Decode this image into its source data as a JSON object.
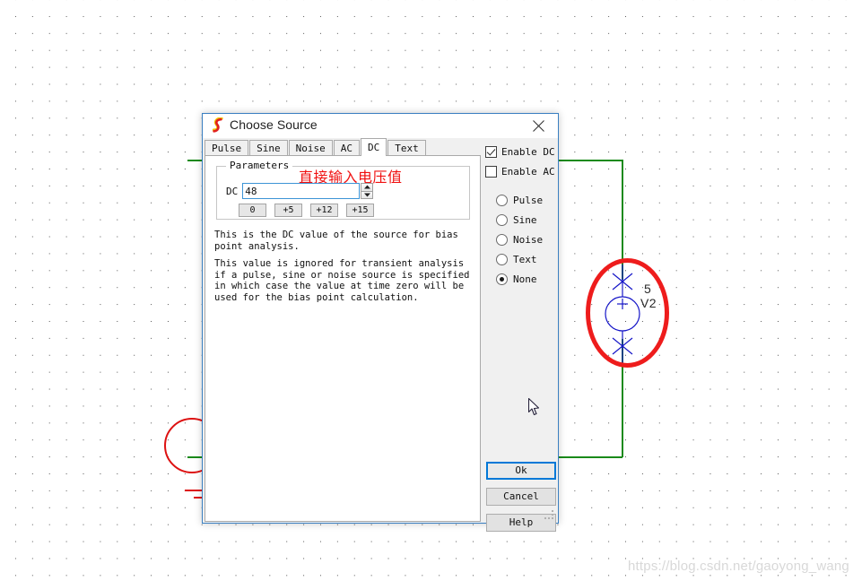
{
  "window": {
    "title": "Choose Source",
    "icon": "ltspice-source-icon",
    "close_label": "✕"
  },
  "tabs": [
    {
      "label": "Pulse",
      "active": false
    },
    {
      "label": "Sine",
      "active": false
    },
    {
      "label": "Noise",
      "active": false
    },
    {
      "label": "AC",
      "active": false
    },
    {
      "label": "DC",
      "active": true
    },
    {
      "label": "Text",
      "active": false
    }
  ],
  "parameters": {
    "legend": "Parameters",
    "dc_label": "DC",
    "dc_value": "48",
    "dc_placeholder": "",
    "presets": [
      "0",
      "+5",
      "+12",
      "+15"
    ],
    "annotation_cn": "直接输入电压值"
  },
  "description": {
    "paragraph1": "This is the DC value of the source for bias point analysis.",
    "paragraph2": "This value is ignored for transient analysis if a pulse, sine or noise source is specified in which case the value at time zero will be used for the bias point calculation."
  },
  "options": {
    "checkboxes": [
      {
        "label": "Enable DC",
        "checked": true
      },
      {
        "label": "Enable AC",
        "checked": false
      }
    ],
    "radios": [
      {
        "label": "Pulse",
        "selected": false
      },
      {
        "label": "Sine",
        "selected": false
      },
      {
        "label": "Noise",
        "selected": false
      },
      {
        "label": "Text",
        "selected": false
      },
      {
        "label": "None",
        "selected": true
      }
    ]
  },
  "buttons": {
    "ok": "Ok",
    "cancel": "Cancel",
    "help": "Help"
  },
  "schematic": {
    "source_value": "5",
    "source_name": "V2",
    "wire_color": "#1a8a1a",
    "highlight_color": "#ee1c1c",
    "symbol_color": "#1616c8",
    "plus_sign": "+"
  },
  "watermark": {
    "text": "https://blog.csdn.net/gaoyong_wang"
  }
}
